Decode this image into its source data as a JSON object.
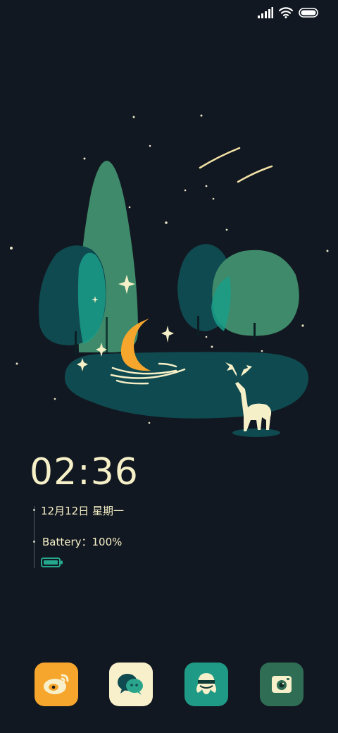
{
  "status_bar": {
    "icons": [
      "signal-icon",
      "wifi-icon",
      "battery-icon"
    ]
  },
  "lockscreen": {
    "time": "02:36",
    "date": "12月12日 星期一",
    "battery_text": "Battery：100%",
    "battery_level": 1.0
  },
  "dock": {
    "apps": [
      {
        "icon": "weibo-icon",
        "color": "#f6a62d"
      },
      {
        "icon": "wechat-icon",
        "color": "#f8f0cb"
      },
      {
        "icon": "qq-icon",
        "color": "#1f9a86"
      },
      {
        "icon": "camera-icon",
        "color": "#2f6d55"
      }
    ]
  },
  "colors": {
    "background": "#121821",
    "text": "#f6f0c8",
    "accent_green": "#3f8a6a",
    "accent_teal": "#0f4a50",
    "moon": "#f6a62d"
  }
}
